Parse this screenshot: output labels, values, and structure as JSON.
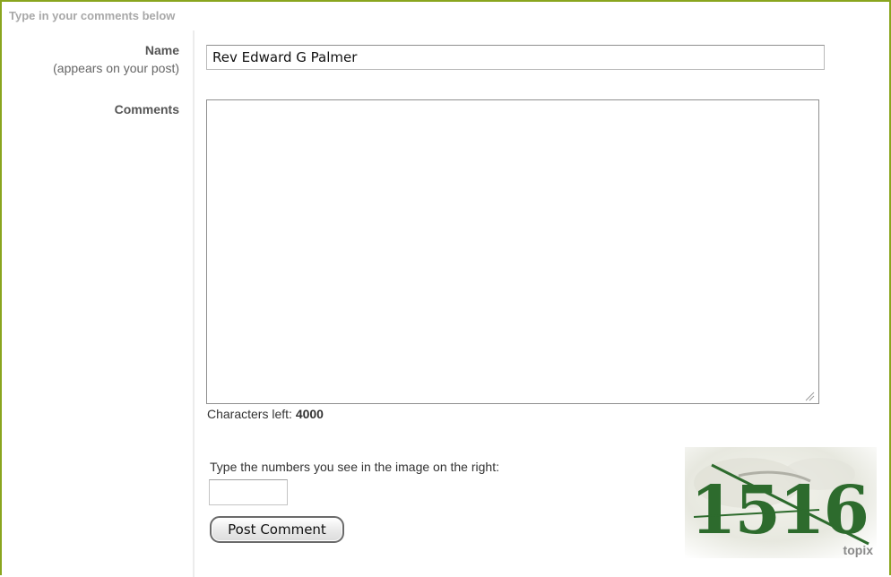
{
  "form": {
    "header": "Type in your comments below",
    "name_label": "Name",
    "name_sublabel": "(appears on your post)",
    "name_value": "Rev Edward G Palmer",
    "comments_label": "Comments",
    "comments_value": "",
    "chars_left_label": "Characters left:",
    "chars_left_value": "4000",
    "captcha_prompt": "Type the numbers you see in the image on the right:",
    "captcha_value": "",
    "captcha_text": "1516",
    "captcha_brand": "topix",
    "submit_label": "Post Comment"
  },
  "colors": {
    "frame_border": "#8aa51e",
    "captcha_digits": "#2d6b2d",
    "header_text": "#a8a8a8"
  }
}
